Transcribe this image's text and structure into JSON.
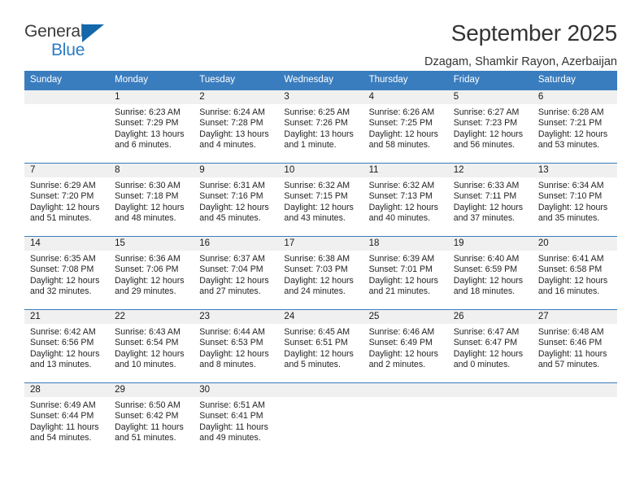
{
  "brand": {
    "name_part1": "General",
    "name_part2": "Blue",
    "triangle_color": "#1268ab",
    "blue_color": "#2b7cc4"
  },
  "header": {
    "title": "September 2025",
    "subtitle": "Dzagam, Shamkir Rayon, Azerbaijan"
  },
  "theme": {
    "header_bar_color": "#3a7dbf",
    "day_band_color": "#f0f0f0",
    "text_color": "#232323"
  },
  "weekdays": [
    "Sunday",
    "Monday",
    "Tuesday",
    "Wednesday",
    "Thursday",
    "Friday",
    "Saturday"
  ],
  "labels": {
    "sunrise_prefix": "Sunrise:",
    "sunset_prefix": "Sunset:",
    "daylight_prefix": "Daylight:"
  },
  "weeks": [
    [
      {
        "day": "",
        "line1": "",
        "line2": "",
        "line3": "",
        "line4": ""
      },
      {
        "day": "1",
        "line1": "Sunrise: 6:23 AM",
        "line2": "Sunset: 7:29 PM",
        "line3": "Daylight: 13 hours",
        "line4": "and 6 minutes."
      },
      {
        "day": "2",
        "line1": "Sunrise: 6:24 AM",
        "line2": "Sunset: 7:28 PM",
        "line3": "Daylight: 13 hours",
        "line4": "and 4 minutes."
      },
      {
        "day": "3",
        "line1": "Sunrise: 6:25 AM",
        "line2": "Sunset: 7:26 PM",
        "line3": "Daylight: 13 hours",
        "line4": "and 1 minute."
      },
      {
        "day": "4",
        "line1": "Sunrise: 6:26 AM",
        "line2": "Sunset: 7:25 PM",
        "line3": "Daylight: 12 hours",
        "line4": "and 58 minutes."
      },
      {
        "day": "5",
        "line1": "Sunrise: 6:27 AM",
        "line2": "Sunset: 7:23 PM",
        "line3": "Daylight: 12 hours",
        "line4": "and 56 minutes."
      },
      {
        "day": "6",
        "line1": "Sunrise: 6:28 AM",
        "line2": "Sunset: 7:21 PM",
        "line3": "Daylight: 12 hours",
        "line4": "and 53 minutes."
      }
    ],
    [
      {
        "day": "7",
        "line1": "Sunrise: 6:29 AM",
        "line2": "Sunset: 7:20 PM",
        "line3": "Daylight: 12 hours",
        "line4": "and 51 minutes."
      },
      {
        "day": "8",
        "line1": "Sunrise: 6:30 AM",
        "line2": "Sunset: 7:18 PM",
        "line3": "Daylight: 12 hours",
        "line4": "and 48 minutes."
      },
      {
        "day": "9",
        "line1": "Sunrise: 6:31 AM",
        "line2": "Sunset: 7:16 PM",
        "line3": "Daylight: 12 hours",
        "line4": "and 45 minutes."
      },
      {
        "day": "10",
        "line1": "Sunrise: 6:32 AM",
        "line2": "Sunset: 7:15 PM",
        "line3": "Daylight: 12 hours",
        "line4": "and 43 minutes."
      },
      {
        "day": "11",
        "line1": "Sunrise: 6:32 AM",
        "line2": "Sunset: 7:13 PM",
        "line3": "Daylight: 12 hours",
        "line4": "and 40 minutes."
      },
      {
        "day": "12",
        "line1": "Sunrise: 6:33 AM",
        "line2": "Sunset: 7:11 PM",
        "line3": "Daylight: 12 hours",
        "line4": "and 37 minutes."
      },
      {
        "day": "13",
        "line1": "Sunrise: 6:34 AM",
        "line2": "Sunset: 7:10 PM",
        "line3": "Daylight: 12 hours",
        "line4": "and 35 minutes."
      }
    ],
    [
      {
        "day": "14",
        "line1": "Sunrise: 6:35 AM",
        "line2": "Sunset: 7:08 PM",
        "line3": "Daylight: 12 hours",
        "line4": "and 32 minutes."
      },
      {
        "day": "15",
        "line1": "Sunrise: 6:36 AM",
        "line2": "Sunset: 7:06 PM",
        "line3": "Daylight: 12 hours",
        "line4": "and 29 minutes."
      },
      {
        "day": "16",
        "line1": "Sunrise: 6:37 AM",
        "line2": "Sunset: 7:04 PM",
        "line3": "Daylight: 12 hours",
        "line4": "and 27 minutes."
      },
      {
        "day": "17",
        "line1": "Sunrise: 6:38 AM",
        "line2": "Sunset: 7:03 PM",
        "line3": "Daylight: 12 hours",
        "line4": "and 24 minutes."
      },
      {
        "day": "18",
        "line1": "Sunrise: 6:39 AM",
        "line2": "Sunset: 7:01 PM",
        "line3": "Daylight: 12 hours",
        "line4": "and 21 minutes."
      },
      {
        "day": "19",
        "line1": "Sunrise: 6:40 AM",
        "line2": "Sunset: 6:59 PM",
        "line3": "Daylight: 12 hours",
        "line4": "and 18 minutes."
      },
      {
        "day": "20",
        "line1": "Sunrise: 6:41 AM",
        "line2": "Sunset: 6:58 PM",
        "line3": "Daylight: 12 hours",
        "line4": "and 16 minutes."
      }
    ],
    [
      {
        "day": "21",
        "line1": "Sunrise: 6:42 AM",
        "line2": "Sunset: 6:56 PM",
        "line3": "Daylight: 12 hours",
        "line4": "and 13 minutes."
      },
      {
        "day": "22",
        "line1": "Sunrise: 6:43 AM",
        "line2": "Sunset: 6:54 PM",
        "line3": "Daylight: 12 hours",
        "line4": "and 10 minutes."
      },
      {
        "day": "23",
        "line1": "Sunrise: 6:44 AM",
        "line2": "Sunset: 6:53 PM",
        "line3": "Daylight: 12 hours",
        "line4": "and 8 minutes."
      },
      {
        "day": "24",
        "line1": "Sunrise: 6:45 AM",
        "line2": "Sunset: 6:51 PM",
        "line3": "Daylight: 12 hours",
        "line4": "and 5 minutes."
      },
      {
        "day": "25",
        "line1": "Sunrise: 6:46 AM",
        "line2": "Sunset: 6:49 PM",
        "line3": "Daylight: 12 hours",
        "line4": "and 2 minutes."
      },
      {
        "day": "26",
        "line1": "Sunrise: 6:47 AM",
        "line2": "Sunset: 6:47 PM",
        "line3": "Daylight: 12 hours",
        "line4": "and 0 minutes."
      },
      {
        "day": "27",
        "line1": "Sunrise: 6:48 AM",
        "line2": "Sunset: 6:46 PM",
        "line3": "Daylight: 11 hours",
        "line4": "and 57 minutes."
      }
    ],
    [
      {
        "day": "28",
        "line1": "Sunrise: 6:49 AM",
        "line2": "Sunset: 6:44 PM",
        "line3": "Daylight: 11 hours",
        "line4": "and 54 minutes."
      },
      {
        "day": "29",
        "line1": "Sunrise: 6:50 AM",
        "line2": "Sunset: 6:42 PM",
        "line3": "Daylight: 11 hours",
        "line4": "and 51 minutes."
      },
      {
        "day": "30",
        "line1": "Sunrise: 6:51 AM",
        "line2": "Sunset: 6:41 PM",
        "line3": "Daylight: 11 hours",
        "line4": "and 49 minutes."
      },
      {
        "day": "",
        "line1": "",
        "line2": "",
        "line3": "",
        "line4": ""
      },
      {
        "day": "",
        "line1": "",
        "line2": "",
        "line3": "",
        "line4": ""
      },
      {
        "day": "",
        "line1": "",
        "line2": "",
        "line3": "",
        "line4": ""
      },
      {
        "day": "",
        "line1": "",
        "line2": "",
        "line3": "",
        "line4": ""
      }
    ]
  ]
}
